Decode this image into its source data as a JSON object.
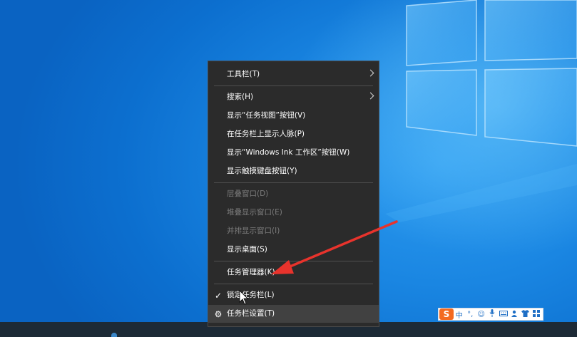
{
  "context_menu": {
    "items": [
      {
        "label": "工具栏(T)",
        "submenu": true
      },
      {
        "label": "搜索(H)",
        "submenu": true
      },
      {
        "label": "显示“任务视图”按钮(V)"
      },
      {
        "label": "在任务栏上显示人脉(P)"
      },
      {
        "label": "显示“Windows Ink 工作区”按钮(W)"
      },
      {
        "label": "显示触摸键盘按钮(Y)"
      },
      {
        "label": "层叠窗口(D)",
        "disabled": true
      },
      {
        "label": "堆叠显示窗口(E)",
        "disabled": true
      },
      {
        "label": "并排显示窗口(I)",
        "disabled": true
      },
      {
        "label": "显示桌面(S)"
      },
      {
        "label": "任务管理器(K)"
      },
      {
        "label": "锁定任务栏(L)",
        "checked": true
      },
      {
        "label": "任务栏设置(T)",
        "icon": "gear-icon"
      }
    ],
    "check_glyph": "✓",
    "gear_glyph": "⚙"
  },
  "ime_toolbar": {
    "logo": "S",
    "mode": "中",
    "punct": "°,",
    "icons": [
      "emoji-icon",
      "microphone-icon",
      "keyboard-icon",
      "user-icon",
      "shirt-icon",
      "grid-icon"
    ]
  },
  "colors": {
    "menu_bg": "#2b2b2b",
    "annotation_arrow": "#e8332c",
    "desktop_blue": "#0a78d6"
  }
}
